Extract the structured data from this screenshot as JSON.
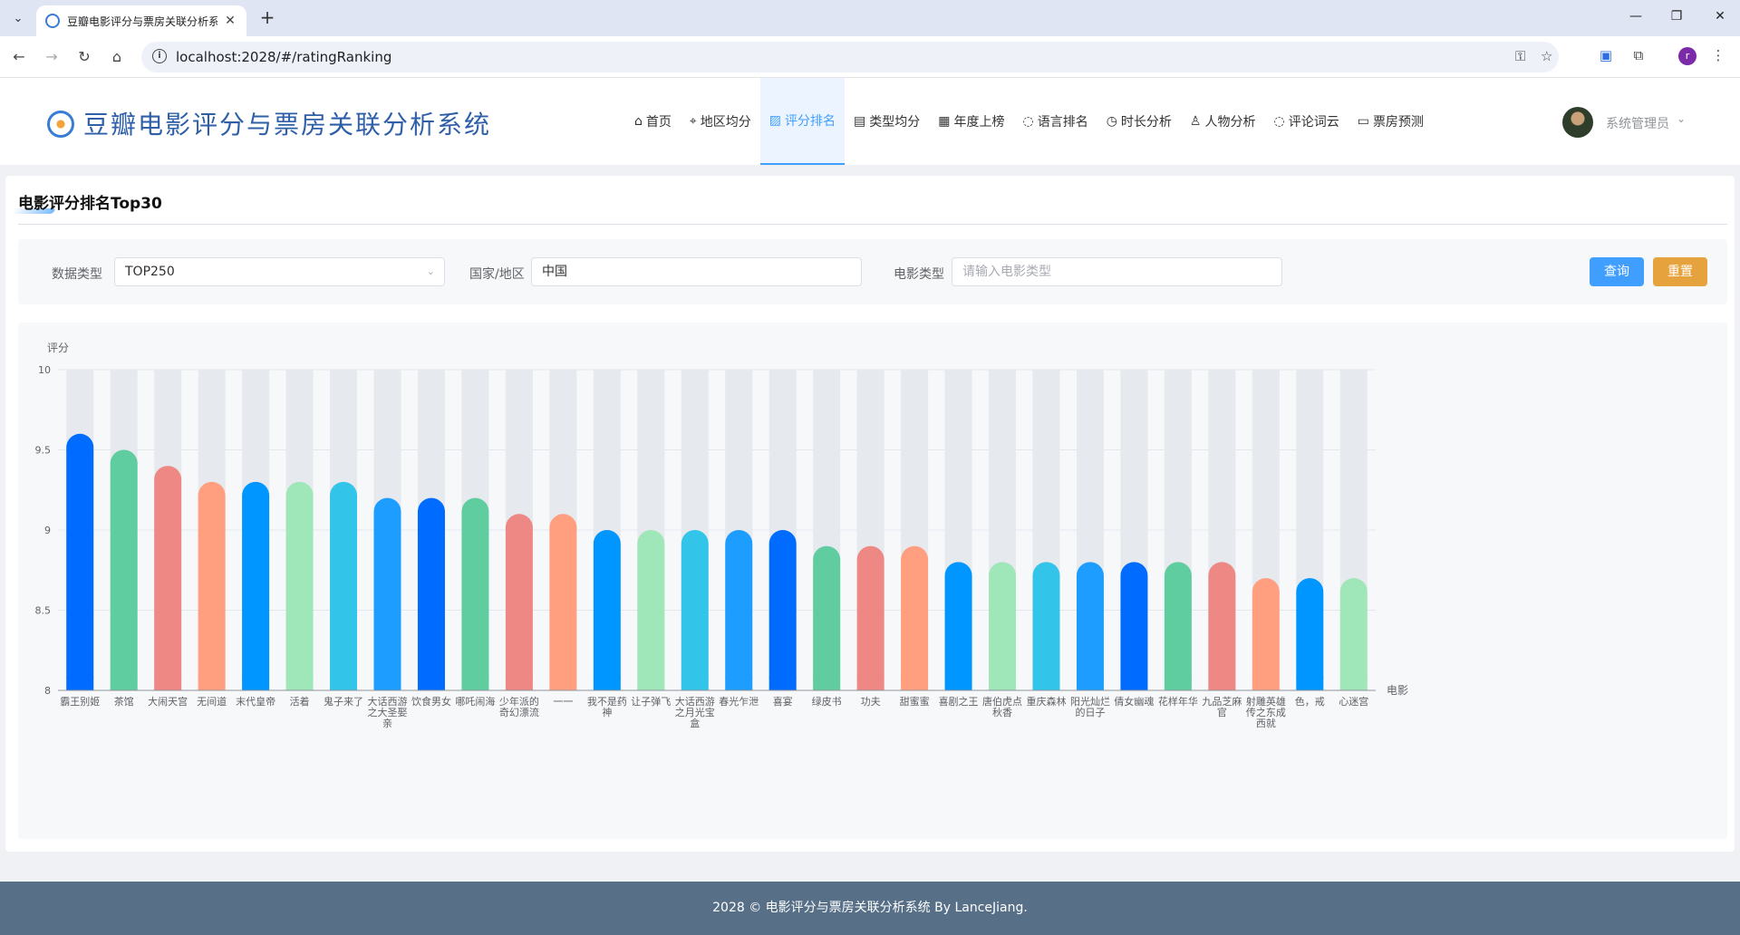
{
  "browser": {
    "tab_title": "豆瓣电影评分与票房关联分析系统",
    "url": "localhost:2028/#/ratingRanking",
    "profile_initial": "r"
  },
  "app": {
    "title": "豆瓣电影评分与票房关联分析系统",
    "menu": [
      {
        "label": "首页",
        "icon": "home-icon"
      },
      {
        "label": "地区均分",
        "icon": "location-icon"
      },
      {
        "label": "评分排名",
        "icon": "trend-chart-icon"
      },
      {
        "label": "类型均分",
        "icon": "notebook-icon"
      },
      {
        "label": "年度上榜",
        "icon": "calendar-icon"
      },
      {
        "label": "语言排名",
        "icon": "chat-icon"
      },
      {
        "label": "时长分析",
        "icon": "stopwatch-icon"
      },
      {
        "label": "人物分析",
        "icon": "user-icon"
      },
      {
        "label": "评论词云",
        "icon": "chat-dots-icon"
      },
      {
        "label": "票房预测",
        "icon": "data-board-icon"
      }
    ],
    "active_menu": "评分排名",
    "user": "系统管理员"
  },
  "card": {
    "title": "电影评分排名Top30"
  },
  "filters": {
    "data_type_label": "数据类型",
    "data_type_value": "TOP250",
    "region_label": "国家/地区",
    "region_value": "中国",
    "genre_label": "电影类型",
    "genre_placeholder": "请输入电影类型",
    "query_label": "查询",
    "reset_label": "重置"
  },
  "chart_data": {
    "type": "bar",
    "ylabel": "评分",
    "xlabel": "电影",
    "ylim": [
      8,
      10
    ],
    "yticks": [
      "8",
      "8.5",
      "9",
      "9.5",
      "10"
    ],
    "grid": true,
    "categories": [
      "霸王别姬",
      "茶馆",
      "大闹天宫",
      "无间道",
      "末代皇帝",
      "活着",
      "鬼子来了",
      "大话西游之大圣娶亲",
      "饮食男女",
      "哪吒闹海",
      "少年派的奇幻漂流",
      "一一",
      "我不是药神",
      "让子弹飞",
      "大话西游之月光宝盒",
      "春光乍泄",
      "喜宴",
      "绿皮书",
      "功夫",
      "甜蜜蜜",
      "喜剧之王",
      "唐伯虎点秋香",
      "重庆森林",
      "阳光灿烂的日子",
      "倩女幽魂",
      "花样年华",
      "九品芝麻官",
      "射雕英雄传之东成西就",
      "色，戒",
      "心迷宫"
    ],
    "values": [
      9.6,
      9.5,
      9.4,
      9.3,
      9.3,
      9.3,
      9.3,
      9.2,
      9.2,
      9.2,
      9.1,
      9.1,
      9.0,
      9.0,
      9.0,
      9.0,
      9.0,
      8.9,
      8.9,
      8.9,
      8.8,
      8.8,
      8.8,
      8.8,
      8.8,
      8.8,
      8.8,
      8.7,
      8.7,
      8.7
    ],
    "colors": [
      "#006cff",
      "#60cda0",
      "#ed8884",
      "#ff9f7f",
      "#0096ff",
      "#9fe6b8",
      "#32c5e9",
      "#1d9dff"
    ],
    "background_bar_color": "#e6e9ed"
  },
  "footer": {
    "text": "2028 © 电影评分与票房关联分析系统 By LanceJiang."
  }
}
